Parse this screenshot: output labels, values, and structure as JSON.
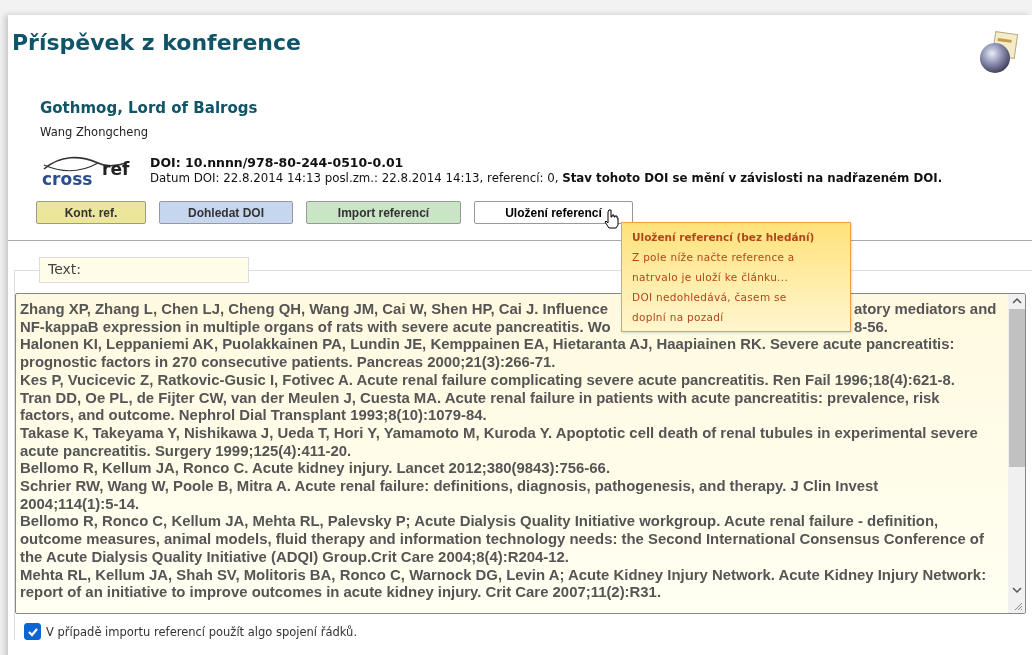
{
  "title": "Příspěvek z konference",
  "article": {
    "title": "Gothmog, Lord of Balrogs",
    "author": "Wang Zhongcheng"
  },
  "logo": {
    "part1": "cross",
    "part2": "ref"
  },
  "doi": {
    "id": "DOI: 10.nnnn/978-80-244-0510-0.01",
    "details": "Datum DOI: 22.8.2014 14:13 posl.zm.: 22.8.2014 14:13, referencí: 0, **Stav tohoto DOI se mění v závislosti na nadřazeném DOI.**"
  },
  "buttons": [
    {
      "label": "Kont. ref.",
      "color": "#ece59c",
      "hovered": false
    },
    {
      "label": "Dohledat DOI",
      "color": "#c6d6ef",
      "hovered": false
    },
    {
      "label": "Import referencí",
      "color": "#c9e5c6",
      "hovered": false
    },
    {
      "label": "Uložení referencí",
      "color": "#ffffff",
      "hovered": true
    }
  ],
  "tooltip": {
    "title": "Uložení referencí (bez hledání)",
    "body": "Z pole níže načte reference a\nnatrvalo je uloží ke článku...\nDOI nedohledává, časem se\ndoplní na pozadí"
  },
  "legend": "Text:",
  "lines": [
    {
      "kind": "split",
      "left": "Zhang XP, Zhang L, Chen LJ, Cheng QH, Wang JM, Cai W, Shen HP, Cai J. Influence",
      "right": "atory mediators and"
    },
    {
      "kind": "split",
      "left": "NF-kappaB expression in multiple organs of rats with severe acute pancreatitis. Wo",
      "right": "8-56."
    },
    {
      "kind": "full",
      "text": "Halonen KI,  Leppaniemi AK,  Puolakkainen PA, Lundin JE,  Kemppainen EA, Hietaranta AJ, Haapiainen RK. Severe acute pancreatitis:"
    },
    {
      "kind": "full",
      "text": "prognostic factors in 270 consecutive patients. Pancreas  2000;21(3):266-71."
    },
    {
      "kind": "full",
      "text": "Kes P, Vucicevic Z, Ratkovic-Gusic I, Fotivec A.  Acute renal failure complicating severe acute pancreatitis. Ren Fail 1996;18(4):621-8."
    },
    {
      "kind": "full",
      "text": "Tran DD, Oe PL, de Fijter CW, van der Meulen J, Cuesta MA. Acute renal failure in patients with acute pancreatitis: prevalence, risk"
    },
    {
      "kind": "full",
      "text": "factors, and outcome. Nephrol Dial Transplant 1993;8(10):1079-84."
    },
    {
      "kind": "full",
      "text": "Takase K, Takeyama Y, Nishikawa J, Ueda T, Hori Y, Yamamoto M, Kuroda Y. Apoptotic cell death of renal tubules in experimental severe"
    },
    {
      "kind": "full",
      "text": "acute pancreatitis. Surgery 1999;125(4):411-20."
    },
    {
      "kind": "full",
      "text": "Bellomo R, Kellum JA, Ronco C. Acute kidney injury. Lancet 2012;380(9843):756-66."
    },
    {
      "kind": "full",
      "text": "Schrier RW, Wang W, Poole B, Mitra A. Acute renal failure: definitions, diagnosis, pathogenesis, and therapy. J Clin Invest"
    },
    {
      "kind": "full",
      "text": "2004;114(1):5-14."
    },
    {
      "kind": "full",
      "text": "Bellomo R, Ronco C, Kellum JA, Mehta RL, Palevsky P; Acute Dialysis Quality Initiative workgroup. Acute renal failure - definition,"
    },
    {
      "kind": "full",
      "text": "outcome measures, animal models, fluid therapy and information technology needs: the Second International Consensus Conference of"
    },
    {
      "kind": "full",
      "text": "the Acute Dialysis Quality Initiative (ADQI) Group.Crit Care 2004;8(4):R204-12."
    },
    {
      "kind": "full",
      "text": "Mehta RL, Kellum JA, Shah SV, Molitoris BA, Ronco C, Warnock DG, Levin A; Acute Kidney Injury Network. Acute Kidney Injury Network:"
    },
    {
      "kind": "full",
      "text": "report of an initiative to improve outcomes in acute kidney injury. Crit Care 2007;11(2):R31."
    }
  ],
  "option": {
    "label": "V případě importu referencí použít algo spojení řádků.",
    "checked": true
  }
}
